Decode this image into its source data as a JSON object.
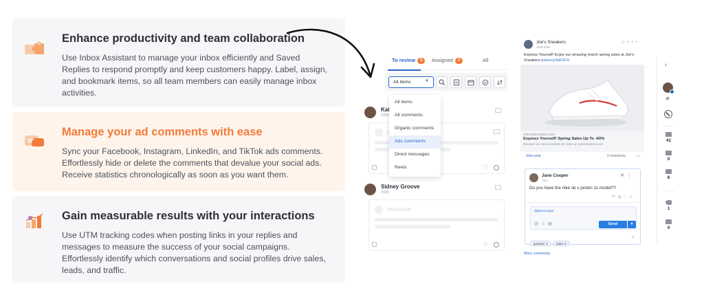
{
  "features": [
    {
      "title": "Enhance productivity and team collaboration",
      "description": "Use Inbox Assistant to manage your inbox efficiently and Saved Replies to respond promptly and keep customers happy. Label, assign, and bookmark items, so all team members can easily manage inbox activities.",
      "icon": "puzzle-icon"
    },
    {
      "title": "Manage your ad comments with ease",
      "description": "Sync your Facebook, Instagram, LinkedIn, and TikTok ads comments. Effortlessly hide or delete the comments that devalue your social ads. Receive statistics chronologically as soon as you want them.",
      "icon": "megaphone-icon"
    },
    {
      "title": "Gain measurable results with your interactions",
      "description": "Use UTM tracking codes when posting links in your replies and messages to measure the success of your social campaigns. Effortlessly identify which conversations and social profiles drive sales, leads, and traffic.",
      "icon": "growth-chart-icon"
    }
  ],
  "inbox": {
    "tabs": [
      {
        "label": "To review",
        "count": "3"
      },
      {
        "label": "Assigned",
        "count": "4"
      },
      {
        "label": "All",
        "count": ""
      }
    ],
    "filter": {
      "selected": "All items"
    },
    "dropdown_options": [
      "All items",
      "All comments",
      "Organic comments",
      "Ads comments",
      "Direct messages",
      "Reels"
    ],
    "highlighted_option": "Ads comments",
    "conversations": [
      {
        "name": "Kath",
        "time": "10m"
      },
      {
        "name": "Sidney Groove",
        "time": "10m"
      }
    ]
  },
  "post": {
    "author": "Joe's Sneakers",
    "time": "Just now",
    "text": "Express Yourself!  Enjoy our amazing march spring sales at Joe's Sneakers",
    "link": "pulse.ly/3dZXFX",
    "ad_domain": "JOESSNEAKERS.COM",
    "ad_title": "Express Yourself! Spring Sales Up To -60%",
    "ad_description": "Discover our new sneakers for sales on joessneakers.com",
    "view_post": "View post",
    "comments_count": "3 comments",
    "more_comments": "More comments"
  },
  "reply": {
    "name": "Jane Cooper",
    "time": "10m",
    "question": "Do you have the nike sb x jordon 1s model??",
    "mention": "@janecooper",
    "send_label": "Send",
    "tags": [
      "question",
      "sales"
    ]
  },
  "sidebar": {
    "stats": [
      {
        "icon": "comment-icon",
        "value": "41"
      },
      {
        "icon": "message-icon",
        "value": "0"
      },
      {
        "icon": "share-icon",
        "value": "6"
      },
      {
        "icon": "tag-icon",
        "value": "1"
      },
      {
        "icon": "note-icon",
        "value": "0"
      }
    ]
  },
  "colors": {
    "accent": "#2b66c9",
    "orange": "#f17b3b",
    "card_bg": "#f6f6f8",
    "card_bg_warm": "#fff4ec"
  }
}
